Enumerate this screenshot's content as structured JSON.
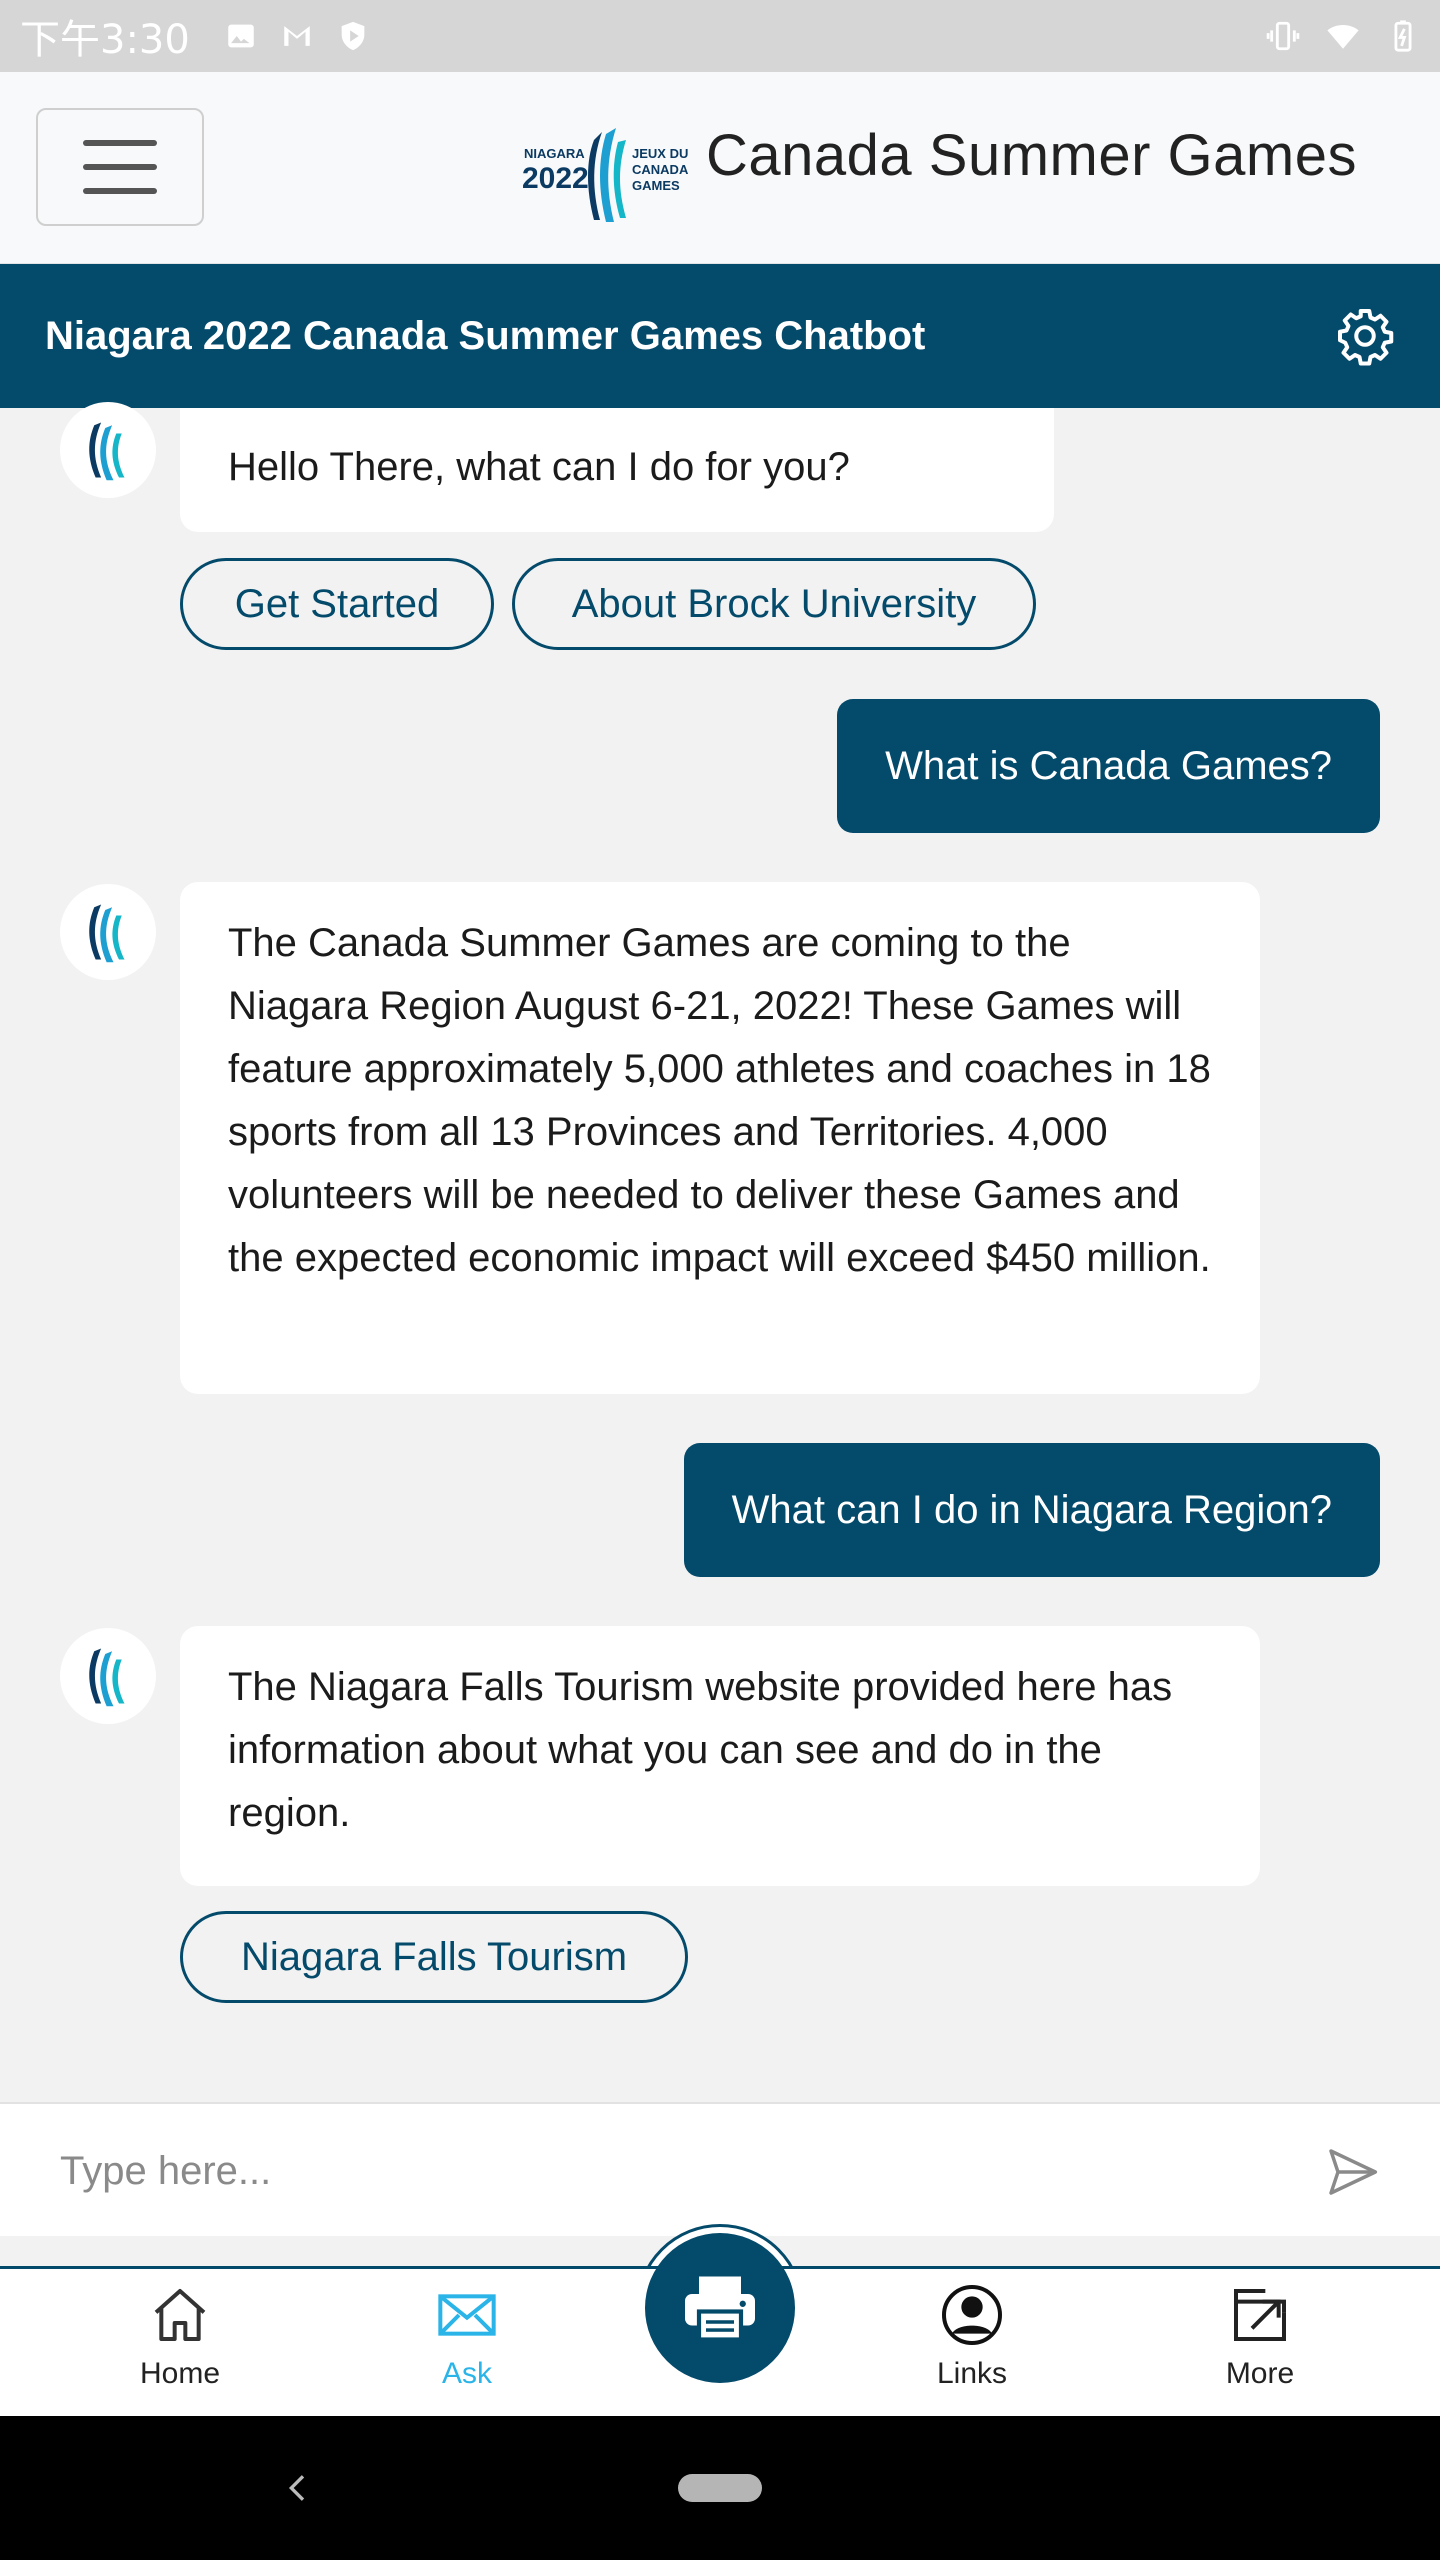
{
  "status_bar": {
    "time": "下午3:30",
    "left_icons": [
      "image-icon",
      "gmail-icon",
      "shield-play-icon"
    ],
    "right_icons": [
      "vibrate-icon",
      "wifi-icon",
      "battery-icon"
    ]
  },
  "header": {
    "brand_title": "Canada Summer Games",
    "logo_lines": [
      "NIAGARA",
      "2022",
      "JEUX DU",
      "CANADA",
      "GAMES"
    ]
  },
  "chat": {
    "title": "Niagara 2022 Canada Summer Games Chatbot",
    "messages": [
      {
        "role": "bot",
        "text": "Hello There, what can I do for you?"
      },
      {
        "role": "user",
        "text": "What is Canada Games?"
      },
      {
        "role": "bot",
        "text": "The Canada Summer Games are coming to the Niagara Region August 6-21, 2022! These Games will feature approximately 5,000 athletes and coaches in 18 sports from all 13 Provinces and Territories. 4,000 volunteers will be needed to deliver these Games and the expected economic impact will exceed $450 million."
      },
      {
        "role": "user",
        "text": "What can I do in Niagara Region?"
      },
      {
        "role": "bot",
        "text": "The Niagara Falls Tourism website provided here has information about what you can see and do in the region."
      }
    ],
    "chips_first": [
      "Get Started",
      "About Brock University"
    ],
    "chips_last": [
      "Niagara Falls Tourism"
    ]
  },
  "input": {
    "placeholder": "Type here...",
    "value": ""
  },
  "bottom_nav": {
    "items": [
      {
        "label": "Home",
        "icon": "home-icon"
      },
      {
        "label": "Ask",
        "icon": "mail-icon",
        "active": true
      },
      {
        "label": "",
        "icon": "printer-icon"
      },
      {
        "label": "Links",
        "icon": "user-circle-icon"
      },
      {
        "label": "More",
        "icon": "external-link-icon"
      }
    ]
  },
  "colors": {
    "primary": "#044a6b",
    "accent": "#2ab4e8",
    "background": "#f2f2f2"
  }
}
